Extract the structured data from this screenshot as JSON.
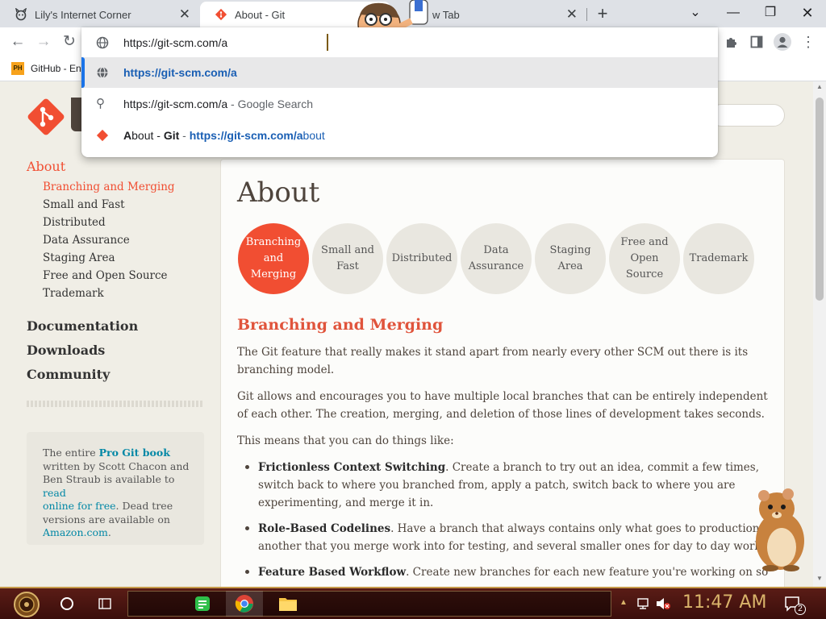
{
  "tabs": [
    {
      "title": "Lily's Internet Corner"
    },
    {
      "title": "About - Git"
    },
    {
      "title": "New Tab",
      "visible_fragment": "w Tab"
    }
  ],
  "omnibox": {
    "input_value": "https://git-scm.com/a",
    "suggestions": [
      {
        "text": "https://git-scm.com/a"
      },
      {
        "text": "https://git-scm.com/a",
        "suffix": " - Google Search"
      },
      {
        "prefix_bold": "A",
        "text": "bout - ",
        "bold_text": "Git",
        "sep": " - ",
        "url_bold": "https://git-scm.com/a",
        "url_rest": "bout"
      }
    ]
  },
  "bookmarks": {
    "item": "GitHub - En"
  },
  "sidebar": {
    "section_active": "About",
    "subitems": [
      "Branching and Merging",
      "Small and Fast",
      "Distributed",
      "Data Assurance",
      "Staging Area",
      "Free and Open Source",
      "Trademark"
    ],
    "main_links": [
      "Documentation",
      "Downloads",
      "Community"
    ],
    "book": {
      "t1": "The entire ",
      "link1": "Pro Git book",
      "t2": "written by Scott Chacon and",
      "t3": "Ben Straub is available to ",
      "link2a": "read",
      "link2b": "online for free",
      "t4": ". Dead tree",
      "t5": "versions are available on",
      "link3": "Amazon.com",
      "t6": "."
    }
  },
  "main": {
    "title": "About",
    "circles": [
      {
        "label": "Branching and Merging",
        "active": true
      },
      {
        "label": "Small and Fast"
      },
      {
        "label": "Distributed"
      },
      {
        "label": "Data Assurance"
      },
      {
        "label": "Staging Area"
      },
      {
        "label": "Free and Open Source"
      },
      {
        "label": "Trademark"
      }
    ],
    "heading": "Branching and Merging",
    "p1": "The Git feature that really makes it stand apart from nearly every other SCM out there is its branching model.",
    "p2": "Git allows and encourages you to have multiple local branches that can be entirely independent of each other. The creation, merging, and deletion of those lines of development takes seconds.",
    "p3": "This means that you can do things like:",
    "bullets": [
      {
        "bold": "Frictionless Context Switching",
        "text": ". Create a branch to try out an idea, commit a few times, switch back to where you branched from, apply a patch, switch back to where you are experimenting, and merge it in."
      },
      {
        "bold": "Role-Based Codelines",
        "text": ". Have a branch that always contains only what goes to production, another that you merge work into for testing, and several smaller ones for day to day work."
      },
      {
        "bold": "Feature Based Workflow",
        "text": ". Create new branches for each new feature you're working on so you can"
      }
    ]
  },
  "taskbar": {
    "time": "11:47 AM",
    "notif_count": "2"
  },
  "colors": {
    "git_orange": "#f14e32",
    "chrome_tab_bg": "#dee1e6",
    "taskbar": "#3a0e0b",
    "link": "#0388a6"
  }
}
